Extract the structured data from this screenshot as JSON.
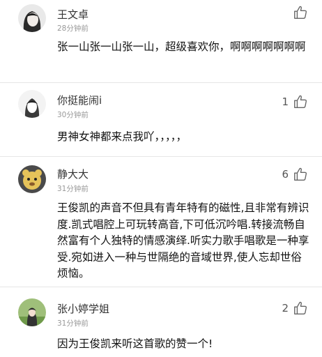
{
  "comments": [
    {
      "name": "王文卓",
      "time": "28分钟前",
      "likes": "",
      "text": "张一山张一山张一山，超级喜欢你，啊啊啊啊啊啊啊",
      "avatar_icon": "dark-hair-girl-avatar"
    },
    {
      "name": "你挺能闹i",
      "time": "30分钟前",
      "likes": "1",
      "text": "男神女神都来点我吖，，，，，",
      "avatar_icon": "monochrome-sketch-avatar"
    },
    {
      "name": "静大大",
      "time": "31分钟前",
      "likes": "6",
      "text": "王俊凯的声音不但具有青年特有的磁性,且非常有辨识度.凯式唱腔上可玩转高音,下可低沉吟唱.转接流畅自然富有个人独特的情感演绎.听实力歌手唱歌是一种享受.宛如进入一种与世隔绝的音域世界,使人忘却世俗烦恼。",
      "avatar_icon": "cartoon-animal-avatar"
    },
    {
      "name": "张小婷学姐",
      "time": "31分钟前",
      "likes": "2",
      "text": "因为王俊凯来听这首歌的赞一个!",
      "avatar_icon": "girl-outdoor-photo-avatar"
    }
  ],
  "colors": {
    "name": "#333333",
    "time": "#999999",
    "text": "#111111",
    "divider": "#e6e6e6",
    "icon": "#666666"
  }
}
